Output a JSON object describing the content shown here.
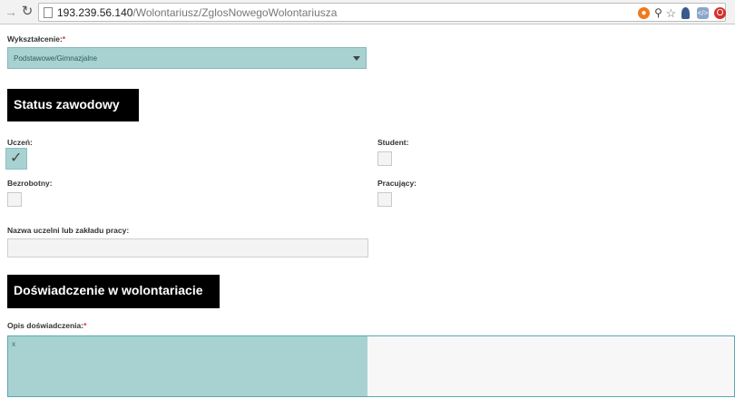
{
  "browser": {
    "url_host": "193.239.56.140",
    "url_path": "/Wolontariusz/ZglosNowegoWolontariusza",
    "forward_icon": "arrow-right-icon",
    "reload_icon": "reload-icon"
  },
  "education": {
    "label": "Wykształcenie:",
    "required_mark": "*",
    "selected": "Podstawowe/Gimnazjalne"
  },
  "status_section": {
    "title": "Status zawodowy",
    "options": [
      {
        "label": "Uczeń:",
        "checked": true
      },
      {
        "label": "Student:",
        "checked": false
      },
      {
        "label": "Bezrobotny:",
        "checked": false
      },
      {
        "label": "Pracujący:",
        "checked": false
      }
    ]
  },
  "workplace": {
    "label": "Nazwa uczelni lub zakładu pracy:",
    "value": ""
  },
  "experience_section": {
    "title": "Doświadczenie w wolontariacie",
    "description_label": "Opis doświadczenia:",
    "required_mark": "*",
    "description_value": "x"
  },
  "colors": {
    "focus_fill": "#a8d2d2",
    "section_bg": "#000000",
    "required": "#dd3333"
  }
}
